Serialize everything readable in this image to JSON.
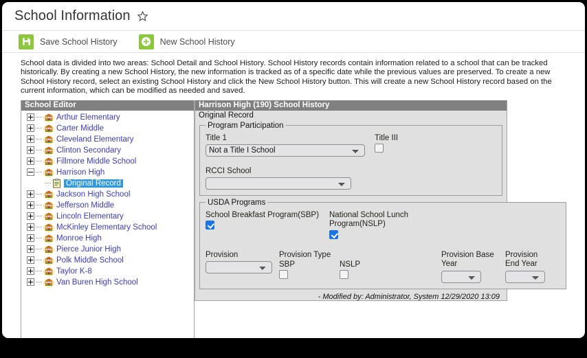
{
  "header": {
    "title": "School Information",
    "favorite_icon": "star-icon"
  },
  "toolbar": {
    "buttons": [
      {
        "label": "Save School History",
        "icon": "save-floppy-icon"
      },
      {
        "label": "New School History",
        "icon": "plus-circle-icon"
      }
    ]
  },
  "description": "School data is divided into two areas: School Detail and School History. School History records contain information related to a school that can be tracked historically. By creating a new School History, the new information is tracked as of a specific date while the previous values are preserved. To create a new School History record, select an existing School History and click the New School History button. This will create a new School History record based on the current information, which can be modified as needed and saved.",
  "tree": {
    "header": "School Editor",
    "items": [
      {
        "label": "Arthur Elementary",
        "expanded": false,
        "icon": "school-icon",
        "selected": false,
        "child": false
      },
      {
        "label": "Carter Middle",
        "expanded": false,
        "icon": "school-icon",
        "selected": false,
        "child": false
      },
      {
        "label": "Cleveland Elementary",
        "expanded": false,
        "icon": "school-icon",
        "selected": false,
        "child": false
      },
      {
        "label": "Clinton Secondary",
        "expanded": false,
        "icon": "school-icon",
        "selected": false,
        "child": false
      },
      {
        "label": "Fillmore Middle School",
        "expanded": false,
        "icon": "school-icon",
        "selected": false,
        "child": false
      },
      {
        "label": "Harrison High",
        "expanded": true,
        "icon": "school-icon",
        "selected": false,
        "child": false
      },
      {
        "label": "Original Record",
        "expanded": null,
        "icon": "document-icon",
        "selected": true,
        "child": true
      },
      {
        "label": "Jackson High School",
        "expanded": false,
        "icon": "school-icon",
        "selected": false,
        "child": false
      },
      {
        "label": "Jefferson Middle",
        "expanded": false,
        "icon": "school-icon",
        "selected": false,
        "child": false
      },
      {
        "label": "Lincoln Elementary",
        "expanded": false,
        "icon": "school-icon",
        "selected": false,
        "child": false
      },
      {
        "label": "McKinley Elementary School",
        "expanded": false,
        "icon": "school-icon",
        "selected": false,
        "child": false
      },
      {
        "label": "Monroe High",
        "expanded": false,
        "icon": "school-icon",
        "selected": false,
        "child": false
      },
      {
        "label": "Pierce Junior High",
        "expanded": false,
        "icon": "school-icon",
        "selected": false,
        "child": false
      },
      {
        "label": "Polk Middle School",
        "expanded": false,
        "icon": "school-icon",
        "selected": false,
        "child": false
      },
      {
        "label": "Taylor K-8",
        "expanded": false,
        "icon": "school-icon",
        "selected": false,
        "child": false
      },
      {
        "label": "Van Buren High School",
        "expanded": false,
        "icon": "school-icon",
        "selected": false,
        "child": false
      }
    ]
  },
  "detail": {
    "header": "Harrison High (190) School History",
    "record_label": "Original Record",
    "program_participation": {
      "legend": "Program Participation",
      "title1_label": "Title 1",
      "title1_value": "Not a Title I School",
      "title1_options": [
        "Not a Title I School"
      ],
      "title3_label": "Title III",
      "title3_checked": false,
      "rcci_label": "RCCI School",
      "rcci_value": "",
      "rcci_options": [
        ""
      ]
    },
    "usda_programs": {
      "legend": "USDA Programs",
      "sbp_label": "School Breakfast Program(SBP)",
      "sbp_checked": true,
      "nslp_label": "National School Lunch Program(NSLP)",
      "nslp_checked": true,
      "provision_label": "Provision",
      "provision_value": "",
      "provision_options": [
        ""
      ],
      "provision_type_label": "Provision Type",
      "provision_type_sbp_label": "SBP",
      "provision_type_sbp_checked": false,
      "provision_type_nslp_label": "NSLP",
      "provision_type_nslp_checked": false,
      "provision_base_year_label": "Provision Base Year",
      "provision_base_year_value": "",
      "provision_base_year_options": [
        ""
      ],
      "provision_end_year_label": "Provision End Year",
      "provision_end_year_value": "",
      "provision_end_year_options": [
        ""
      ]
    },
    "modified_footer": "- Modified by: Administrator, System 12/29/2020 13:09"
  },
  "colors": {
    "accent_green": "#8dc63f",
    "panel_header_gray": "#808080",
    "selection_blue": "#2d9ae8",
    "checkbox_blue": "#1b73e8",
    "link_blue": "#3b3bc4"
  }
}
